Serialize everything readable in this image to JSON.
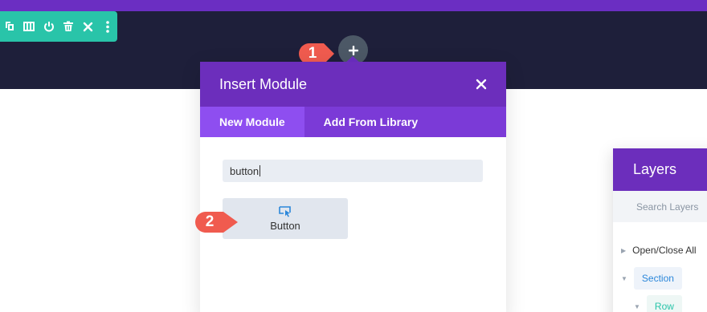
{
  "toolbar": {
    "icons": [
      "duplicate-icon",
      "columns-icon",
      "power-icon",
      "trash-icon",
      "close-icon",
      "more-icon"
    ]
  },
  "insert_button": {
    "icon": "plus-icon"
  },
  "callouts": {
    "first": "1",
    "second": "2"
  },
  "modal": {
    "title": "Insert Module",
    "tabs": [
      {
        "label": "New Module",
        "active": true
      },
      {
        "label": "Add From Library",
        "active": false
      }
    ],
    "search_value": "button",
    "results": [
      {
        "label": "Button",
        "icon": "cursor-icon"
      }
    ]
  },
  "layers": {
    "title": "Layers",
    "search_placeholder": "Search Layers",
    "open_close_all": "Open/Close All",
    "items": [
      {
        "label": "Section",
        "color": "#2b87da"
      },
      {
        "label": "Row",
        "color": "#29c4a9"
      }
    ]
  },
  "colors": {
    "purple": "#6c2ebc",
    "purple_light": "#8e4ef0",
    "teal": "#29c4a9",
    "dark": "#1e1f3a",
    "callout_red": "#f05b4f"
  }
}
